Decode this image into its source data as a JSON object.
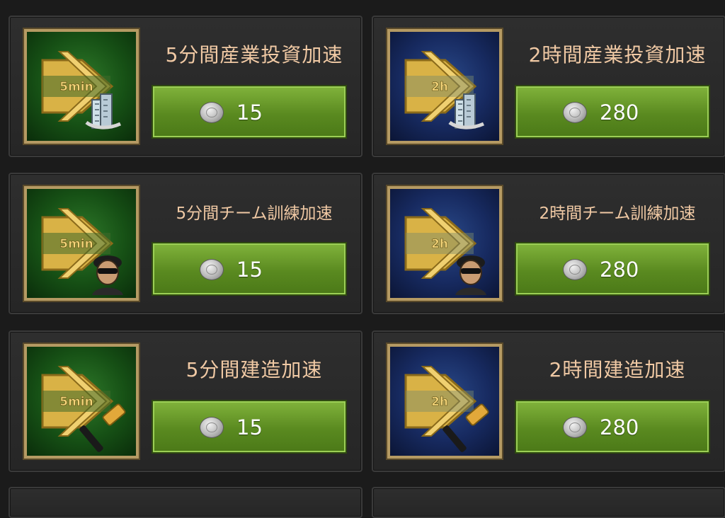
{
  "items": [
    {
      "title": "5分間産業投資加速",
      "badge": "5min",
      "price": "15",
      "theme": "green",
      "overlay": "building-icon",
      "size": "big"
    },
    {
      "title": "2時間産業投資加速",
      "badge": "2h",
      "price": "280",
      "theme": "blue",
      "overlay": "building-icon",
      "size": "big"
    },
    {
      "title": "5分間チーム訓練加速",
      "badge": "5min",
      "price": "15",
      "theme": "green",
      "overlay": "soldier-icon",
      "size": "small"
    },
    {
      "title": "2時間チーム訓練加速",
      "badge": "2h",
      "price": "280",
      "theme": "blue",
      "overlay": "soldier-icon",
      "size": "small"
    },
    {
      "title": "5分間建造加速",
      "badge": "5min",
      "price": "15",
      "theme": "green",
      "overlay": "hammer-icon",
      "size": "big"
    },
    {
      "title": "2時間建造加速",
      "badge": "2h",
      "price": "280",
      "theme": "blue",
      "overlay": "hammer-icon",
      "size": "big"
    }
  ],
  "currency_icon": "silver-coin-icon",
  "colors": {
    "title_text": "#f0c9a4",
    "button_green": "#6a9e2b",
    "frame_gold": "#b59a63"
  }
}
